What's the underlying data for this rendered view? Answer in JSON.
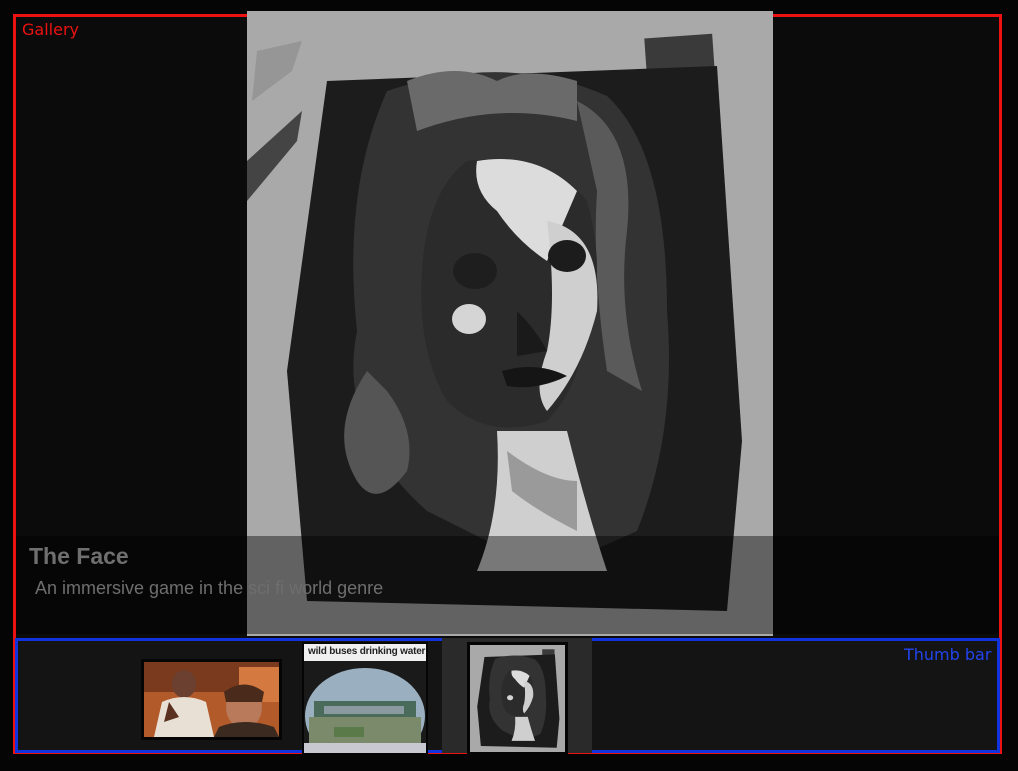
{
  "gallery": {
    "frame_label": "Gallery",
    "current": {
      "title": "The Face",
      "description": "An immersive game in the sci fi world genre",
      "image_icon": "portrait-painting"
    }
  },
  "thumb_bar": {
    "label": "Thumb bar",
    "thumbnails": [
      {
        "image_icon": "game-scene-two-men",
        "active": false
      },
      {
        "image_icon": "bus-photo",
        "caption": "wild buses drinking water",
        "active": false
      },
      {
        "image_icon": "portrait-painting",
        "active": true
      }
    ]
  },
  "colors": {
    "gallery_frame": "#ee1111",
    "thumb_bar_frame": "#1133dd",
    "background": "#050505"
  }
}
